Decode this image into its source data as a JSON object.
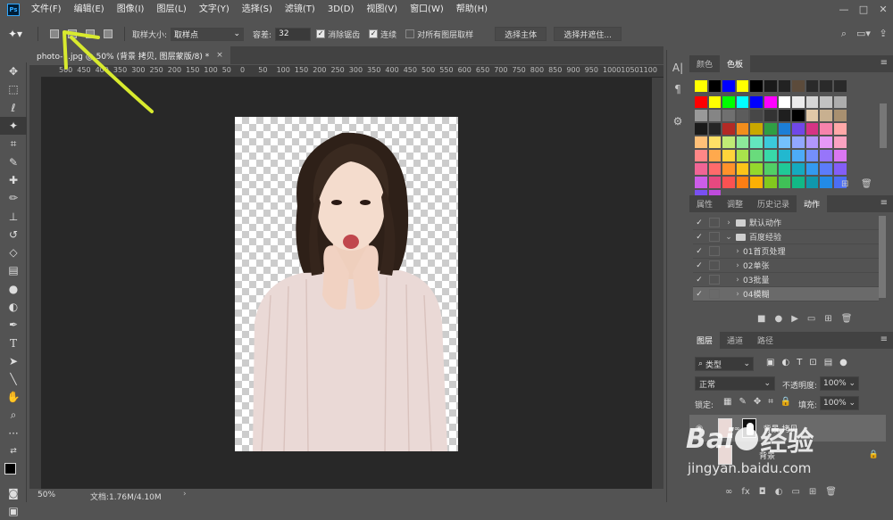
{
  "app": {
    "logo": "Ps"
  },
  "menu": [
    "文件(F)",
    "编辑(E)",
    "图像(I)",
    "图层(L)",
    "文字(Y)",
    "选择(S)",
    "滤镜(T)",
    "3D(D)",
    "视图(V)",
    "窗口(W)",
    "帮助(H)"
  ],
  "window_controls": {
    "minimize": "—",
    "maximize": "□",
    "close": "✕"
  },
  "options": {
    "sample_size_label": "取样大小:",
    "sample_size_value": "取样点",
    "tolerance_label": "容差:",
    "tolerance_value": "32",
    "antialias_label": "消除锯齿",
    "contiguous_label": "连续",
    "sample_all_label": "对所有图层取样",
    "select_subject": "选择主体",
    "select_mask": "选择并遮住..."
  },
  "document": {
    "tab_title": "photo-1.jpg @ 50% (背景 拷贝, 图层蒙版/8) *",
    "close": "×",
    "zoom": "50%",
    "doc_info": "文档:1.76M/4.10M"
  },
  "ruler_top_labels": [
    "500",
    "450",
    "400",
    "350",
    "300",
    "250",
    "200",
    "150",
    "100",
    "50",
    "0",
    "50",
    "100",
    "150",
    "200",
    "250",
    "300",
    "350",
    "400",
    "450",
    "500",
    "550",
    "600",
    "650",
    "700",
    "750",
    "800",
    "850",
    "900",
    "950",
    "1000",
    "1050",
    "1100"
  ],
  "color_panel": {
    "tabs": [
      "颜色",
      "色板"
    ],
    "active": "色板"
  },
  "swatches": {
    "recent": [
      "#ffff00",
      "#000000",
      "#0000ff",
      "#ffff00",
      "#000000",
      "#1a1a1a",
      "#222222",
      "#5c4b3b",
      "#2a2a2a",
      "#2a2a2a",
      "#2a2a2a"
    ],
    "grid": [
      "#ff0000",
      "#ffff00",
      "#00ff00",
      "#00ffff",
      "#0000ff",
      "#ff00ff",
      "#ffffff",
      "#ebebeb",
      "#d6d6d6",
      "#c2c2c2",
      "#adadad",
      "#999999",
      "#858585",
      "#707070",
      "#5c5c5c",
      "#474747",
      "#333333",
      "#1f1f1f",
      "#000000",
      "#e0c8a8",
      "#c8b090",
      "#a89070",
      "#1a1a1a",
      "#262626",
      "#b32a25",
      "#f28e1c",
      "#c9a800",
      "#2f9e44",
      "#1c7ed6",
      "#7048e8",
      "#d63384",
      "#f783ac",
      "#ffa8a8",
      "#ffc078",
      "#ffe066",
      "#c0eb75",
      "#8ce99a",
      "#63e6be",
      "#3bc9db",
      "#74c0fc",
      "#91a7ff",
      "#b197fc",
      "#e599f7",
      "#faa2c1",
      "#ff8787",
      "#ffa94d",
      "#ffd43b",
      "#a9e34b",
      "#69db7c",
      "#38d9a9",
      "#22b8cf",
      "#4dabf7",
      "#748ffc",
      "#9775fa",
      "#da77f2",
      "#f06595",
      "#ff6b6b",
      "#ff922b",
      "#fcc419",
      "#94d82d",
      "#51cf66",
      "#20c997",
      "#15aabf",
      "#339af0",
      "#5c7cfa",
      "#845ef7",
      "#cc5de8",
      "#e64980",
      "#fa5252",
      "#fd7e14",
      "#fab005",
      "#82c91e",
      "#40c057",
      "#12b886",
      "#1098ad",
      "#228be6",
      "#4c6ef5",
      "#7950f2",
      "#be4bdb"
    ]
  },
  "actions_panel": {
    "tabs": [
      "属性",
      "调整",
      "历史记录",
      "动作"
    ],
    "active": "动作",
    "items": [
      {
        "label": "默认动作",
        "level": 0,
        "type": "folder",
        "expanded": false
      },
      {
        "label": "百度经验",
        "level": 0,
        "type": "folder",
        "expanded": true
      },
      {
        "label": "01首页处理",
        "level": 1,
        "type": "action"
      },
      {
        "label": "02单张",
        "level": 1,
        "type": "action"
      },
      {
        "label": "03批量",
        "level": 1,
        "type": "action"
      },
      {
        "label": "04模糊",
        "level": 1,
        "type": "action"
      }
    ]
  },
  "layers_panel": {
    "tabs": [
      "图层",
      "通道",
      "路径"
    ],
    "active": "图层",
    "filter_label": "类型",
    "blend_mode": "正常",
    "opacity_label": "不透明度:",
    "opacity_value": "100%",
    "lock_label": "锁定:",
    "fill_label": "填充:",
    "fill_value": "100%",
    "layers": [
      {
        "name": "背景 拷贝",
        "visible": true,
        "masked": true
      },
      {
        "name": "背景",
        "visible": false,
        "locked": true
      }
    ]
  },
  "watermark": {
    "brand": "Bai",
    "brand2": "经验",
    "url": "jingyan.baidu.com"
  }
}
